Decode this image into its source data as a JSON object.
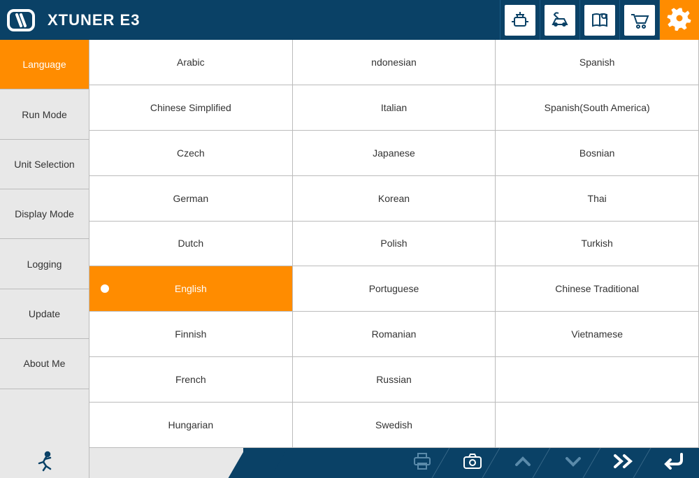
{
  "header": {
    "title": "XTUNER E3"
  },
  "sidebar": {
    "items": [
      {
        "label": "Language",
        "active": true
      },
      {
        "label": "Run Mode",
        "active": false
      },
      {
        "label": "Unit Selection",
        "active": false
      },
      {
        "label": "Display Mode",
        "active": false
      },
      {
        "label": "Logging",
        "active": false
      },
      {
        "label": "Update",
        "active": false
      },
      {
        "label": "About Me",
        "active": false
      }
    ]
  },
  "languages": {
    "selected": "English",
    "grid": [
      [
        "Arabic",
        "ndonesian",
        "Spanish"
      ],
      [
        "Chinese Simplified",
        "Italian",
        "Spanish(South America)"
      ],
      [
        "Czech",
        "Japanese",
        "Bosnian"
      ],
      [
        "German",
        "Korean",
        "Thai"
      ],
      [
        "Dutch",
        "Polish",
        "Turkish"
      ],
      [
        "English",
        "Portuguese",
        "Chinese Traditional"
      ],
      [
        "Finnish",
        "Romanian",
        "Vietnamese"
      ],
      [
        "French",
        "Russian",
        ""
      ],
      [
        "Hungarian",
        "Swedish",
        ""
      ]
    ]
  },
  "colors": {
    "primary": "#0a4166",
    "accent": "#ff8c00"
  }
}
